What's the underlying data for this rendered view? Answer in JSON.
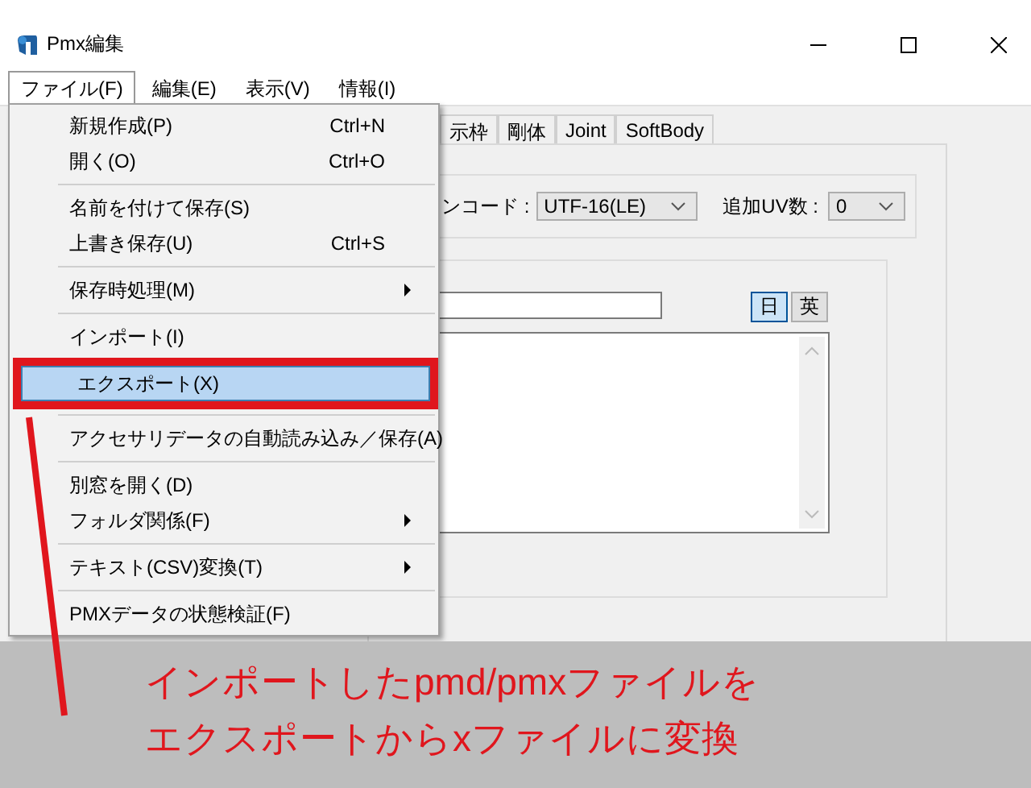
{
  "window": {
    "title": "Pmx編集"
  },
  "menu_bar": [
    {
      "label": "ファイル(F)",
      "selected": true
    },
    {
      "label": "編集(E)",
      "selected": false
    },
    {
      "label": "表示(V)",
      "selected": false
    },
    {
      "label": "情報(I)",
      "selected": false
    }
  ],
  "file_menu": [
    {
      "kind": "item",
      "label": "新規作成(P)",
      "shortcut": "Ctrl+N",
      "submenu": false,
      "selected": false
    },
    {
      "kind": "item",
      "label": "開く(O)",
      "shortcut": "Ctrl+O",
      "submenu": false,
      "selected": false
    },
    {
      "kind": "separator"
    },
    {
      "kind": "item",
      "label": "名前を付けて保存(S)",
      "submenu": false,
      "selected": false
    },
    {
      "kind": "item",
      "label": "上書き保存(U)",
      "shortcut": "Ctrl+S",
      "submenu": false,
      "selected": false
    },
    {
      "kind": "separator"
    },
    {
      "kind": "item",
      "label": "保存時処理(M)",
      "submenu": true,
      "selected": false
    },
    {
      "kind": "separator"
    },
    {
      "kind": "item",
      "label": "インポート(I)",
      "submenu": false,
      "selected": false
    },
    {
      "kind": "item",
      "label": "エクスポート(X)",
      "submenu": false,
      "selected": true
    },
    {
      "kind": "separator"
    },
    {
      "kind": "item",
      "label": "アクセサリデータの自動読み込み／保存(A)",
      "submenu": false,
      "selected": false
    },
    {
      "kind": "separator"
    },
    {
      "kind": "item",
      "label": "別窓を開く(D)",
      "submenu": false,
      "selected": false
    },
    {
      "kind": "item",
      "label": "フォルダ関係(F)",
      "submenu": true,
      "selected": false
    },
    {
      "kind": "separator"
    },
    {
      "kind": "item",
      "label": "テキスト(CSV)変換(T)",
      "submenu": true,
      "selected": false
    },
    {
      "kind": "separator"
    },
    {
      "kind": "item",
      "label": "PMXデータの状態検証(F)",
      "submenu": false,
      "selected": false
    }
  ],
  "tabs": [
    {
      "label": "示枠",
      "selected": false
    },
    {
      "label": "剛体",
      "selected": false
    },
    {
      "label": "Joint",
      "selected": false
    },
    {
      "label": "SoftBody",
      "selected": false
    }
  ],
  "encoding": {
    "label": "ンコード :",
    "value": "UTF-16(LE)"
  },
  "uv_count": {
    "label": "追加UV数 :",
    "value": "0"
  },
  "language_buttons": [
    {
      "label": "日",
      "selected": true
    },
    {
      "label": "英",
      "selected": false
    }
  ],
  "annotation": {
    "lines": [
      "インポートしたpmd/pmxファイルを",
      "エクスポートからxファイルに変換"
    ]
  }
}
